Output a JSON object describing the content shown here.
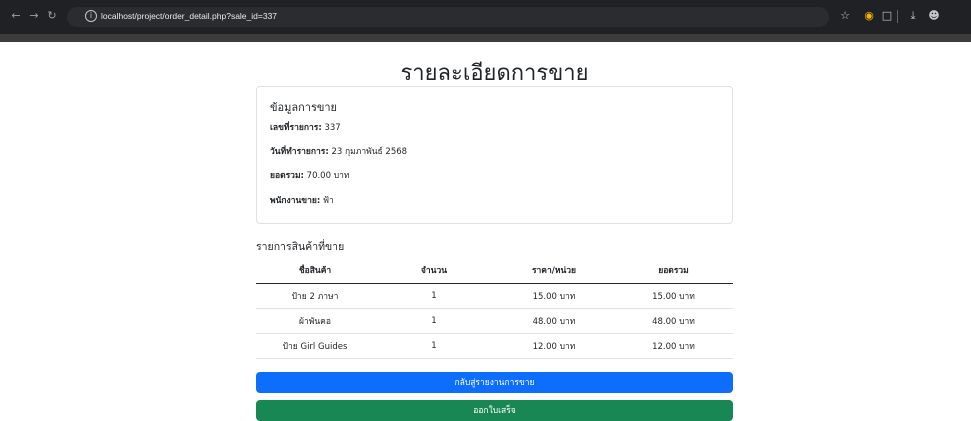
{
  "browser": {
    "url": "localhost/project/order_detail.php?sale_id=337",
    "back_icon": "arrow-left-icon",
    "forward_icon": "arrow-right-icon",
    "reload_icon": "reload-icon"
  },
  "page": {
    "title": "รายละเอียดการขาย"
  },
  "info": {
    "heading": "ข้อมูลการขาย",
    "order_no_label": "เลขที่รายการ:",
    "order_no": "337",
    "date_label": "วันที่ทำรายการ:",
    "date": "23 กุมภาพันธ์ 2568",
    "total_label": "ยอดรวม:",
    "total": "70.00 บาท",
    "staff_label": "พนักงานขาย:",
    "staff": "ฟ้า"
  },
  "items": {
    "heading": "รายการสินค้าที่ขาย",
    "columns": [
      "ชื่อสินค้า",
      "จำนวน",
      "ราคา/หน่วย",
      "ยอดรวม"
    ],
    "rows": [
      [
        "ป้าย 2 ภาษา",
        "1",
        "15.00 บาท",
        "15.00 บาท"
      ],
      [
        "ผ้าพันคอ",
        "1",
        "48.00 บาท",
        "48.00 บาท"
      ],
      [
        "ป้าย Girl Guides",
        "1",
        "12.00 บาท",
        "12.00 บาท"
      ]
    ]
  },
  "buttons": {
    "back": "กลับสู่รายงานการขาย",
    "print": "ออกใบเสร็จ"
  }
}
